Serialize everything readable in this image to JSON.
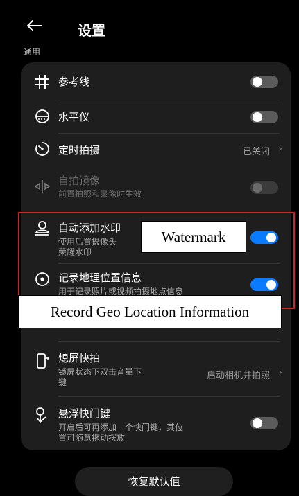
{
  "header": {
    "back_icon": "arrow-left-icon",
    "title": "设置",
    "section": "通用"
  },
  "items": [
    {
      "label": "参考线",
      "toggle": "off",
      "icon": "grid-icon"
    },
    {
      "label": "水平仪",
      "toggle": "off",
      "icon": "level-icon"
    },
    {
      "label": "定时拍摄",
      "value": "已关闭",
      "icon": "timer-icon"
    },
    {
      "label": "自拍镜像",
      "sub": "前置拍照和录像时生效",
      "toggle": "disabled",
      "icon": "mirror-icon"
    },
    {
      "label": "自动添加水印",
      "sub": "使用后置摄像头\n荣耀水印",
      "toggle": "on",
      "icon": "watermark-icon"
    },
    {
      "label": "记录地理位置信息",
      "sub": "用于记录照片或视频拍摄地点信息",
      "toggle": "on",
      "icon": "location-icon"
    },
    {
      "label": "熄屏快拍",
      "sub": "锁屏状态下双击音量下\n键",
      "value": "启动相机并拍照",
      "icon": "quick-snap-icon"
    },
    {
      "label": "悬浮快门键",
      "sub": "开启后可再添加一个快门键，其位\n置可随意拖动摆放",
      "toggle": "off",
      "icon": "floating-shutter-icon"
    }
  ],
  "annotations": {
    "watermark": "Watermark",
    "geo": "Record Geo Location Information"
  },
  "reset_label": "恢复默认值",
  "colors": {
    "accent": "#0a7bff",
    "highlight": "#c62828",
    "background": "#000000",
    "card": "#1e1e1e"
  }
}
